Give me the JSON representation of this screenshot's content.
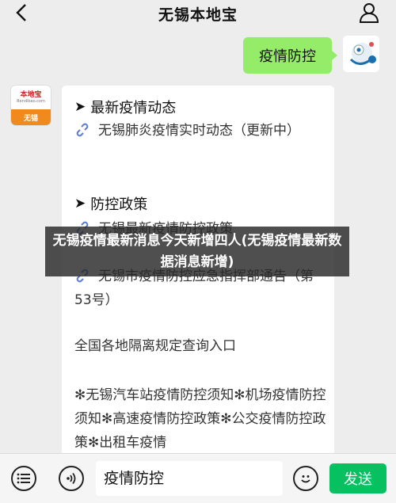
{
  "header": {
    "title": "无锡本地宝"
  },
  "outgoing_message": {
    "text": "疫情防控"
  },
  "bot": {
    "logo_text": "本地宝",
    "logo_url": "Bendibao.com",
    "logo_city": "无锡"
  },
  "incoming_message": {
    "section1_title": "最新疫情动态",
    "link1": "无锡肺炎疫情实时动态（更新中）",
    "section2_title": "防控政策",
    "link2": "无锡最新疫情防控政策",
    "link3": "无锡市疫情防控应急指挥部通告（第53号）",
    "plain1": "全国各地隔离规定查询入口",
    "star_items": "✻无锡汽车站疫情防控须知✻机场疫情防控须知✻高速疫情防控政策✻公交疫情防控政策✻出租车疫情"
  },
  "overlay": {
    "text": "无锡疫情最新消息今天新增四人(无锡疫情最新数据消息新增)"
  },
  "input": {
    "value": "疫情防控"
  },
  "send_button": {
    "label": "发送"
  },
  "colors": {
    "send": "#07c160",
    "bubble_out": "#95ec69",
    "link_icon": "#5b7bd5"
  }
}
